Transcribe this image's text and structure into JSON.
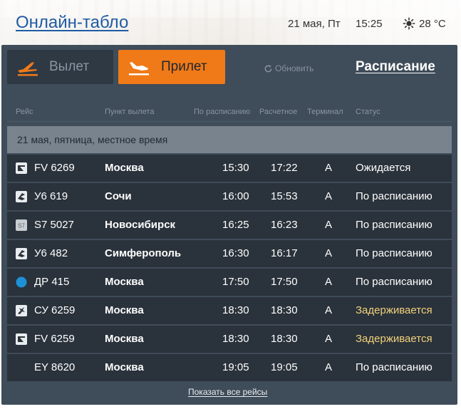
{
  "header": {
    "title": "Онлайн-табло",
    "date": "21 мая, Пт",
    "time": "15:25",
    "temperature": "28 °C",
    "weather_icon": "sun-icon"
  },
  "tabs": {
    "departure": "Вылет",
    "arrival": "Прилет",
    "active": "arrival"
  },
  "toolbar": {
    "refresh": "Обновить",
    "schedule": "Расписание"
  },
  "columns": {
    "flight": "Рейс",
    "origin": "Пункт вылета",
    "scheduled": "По расписанию",
    "estimated": "Расчетное",
    "terminal": "Терминал",
    "status": "Статус"
  },
  "date_band": "21 мая, пятница, местное время",
  "flights": [
    {
      "flight": "FV 6269",
      "city": "Москва",
      "scheduled": "15:30",
      "estimated": "17:22",
      "terminal": "A",
      "status": "Ожидается",
      "delayed": false,
      "logo": "airline-logo-fv"
    },
    {
      "flight": "У6 619",
      "city": "Сочи",
      "scheduled": "16:00",
      "estimated": "15:53",
      "terminal": "A",
      "status": "По расписанию",
      "delayed": false,
      "logo": "airline-logo-u6"
    },
    {
      "flight": "S7 5027",
      "city": "Новосибирск",
      "scheduled": "16:25",
      "estimated": "16:23",
      "terminal": "A",
      "status": "По расписанию",
      "delayed": false,
      "logo": "airline-logo-s7"
    },
    {
      "flight": "У6 482",
      "city": "Симферополь",
      "scheduled": "16:30",
      "estimated": "16:17",
      "terminal": "A",
      "status": "По расписанию",
      "delayed": false,
      "logo": "airline-logo-u6"
    },
    {
      "flight": "ДР 415",
      "city": "Москва",
      "scheduled": "17:50",
      "estimated": "17:50",
      "terminal": "A",
      "status": "По расписанию",
      "delayed": false,
      "logo": "airline-logo-dp"
    },
    {
      "flight": "СУ 6259",
      "city": "Москва",
      "scheduled": "18:30",
      "estimated": "18:30",
      "terminal": "A",
      "status": "Задерживается",
      "delayed": true,
      "logo": "airline-logo-su"
    },
    {
      "flight": "FV 6259",
      "city": "Москва",
      "scheduled": "18:30",
      "estimated": "18:30",
      "terminal": "A",
      "status": "Задерживается",
      "delayed": true,
      "logo": "airline-logo-fv"
    },
    {
      "flight": "EY 8620",
      "city": "Москва",
      "scheduled": "19:05",
      "estimated": "19:05",
      "terminal": "A",
      "status": "По расписанию",
      "delayed": false,
      "logo": "none"
    }
  ],
  "footer": {
    "show_all": "Показать все рейсы"
  },
  "colors": {
    "accent": "#f07a18",
    "board_bg": "#3f4c59",
    "row_bg": "#2a323b",
    "delayed": "#f1d27a",
    "title": "#1f5ba3"
  }
}
